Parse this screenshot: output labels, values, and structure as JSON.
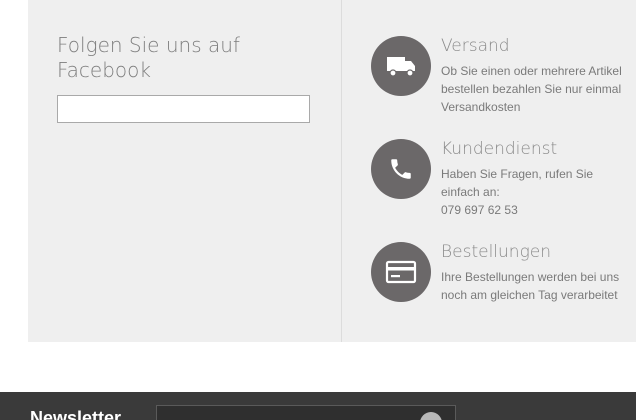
{
  "facebook": {
    "title": "Folgen Sie uns auf Facebook"
  },
  "services": [
    {
      "title": "Versand",
      "icon": "truck-icon",
      "lines": [
        "Ob Sie einen oder mehrere Artikel",
        "bestellen bezahlen Sie nur einmal",
        "Versandkosten"
      ]
    },
    {
      "title": "Kundendienst",
      "icon": "phone-icon",
      "lines": [
        "Haben Sie Fragen, rufen Sie",
        "einfach an:",
        "079 697 62 53"
      ]
    },
    {
      "title": "Bestellungen",
      "icon": "credit-card-icon",
      "lines": [
        "Ihre Bestellungen werden bei uns",
        "noch am gleichen Tag verarbeitet"
      ]
    }
  ],
  "newsletter": {
    "label": "Newsletter",
    "button_icon": "submit-arrow-icon"
  },
  "colors": {
    "panel_bg": "#efefef",
    "icon_circle": "#6b6869",
    "footer_bg": "#3a3a3a"
  }
}
